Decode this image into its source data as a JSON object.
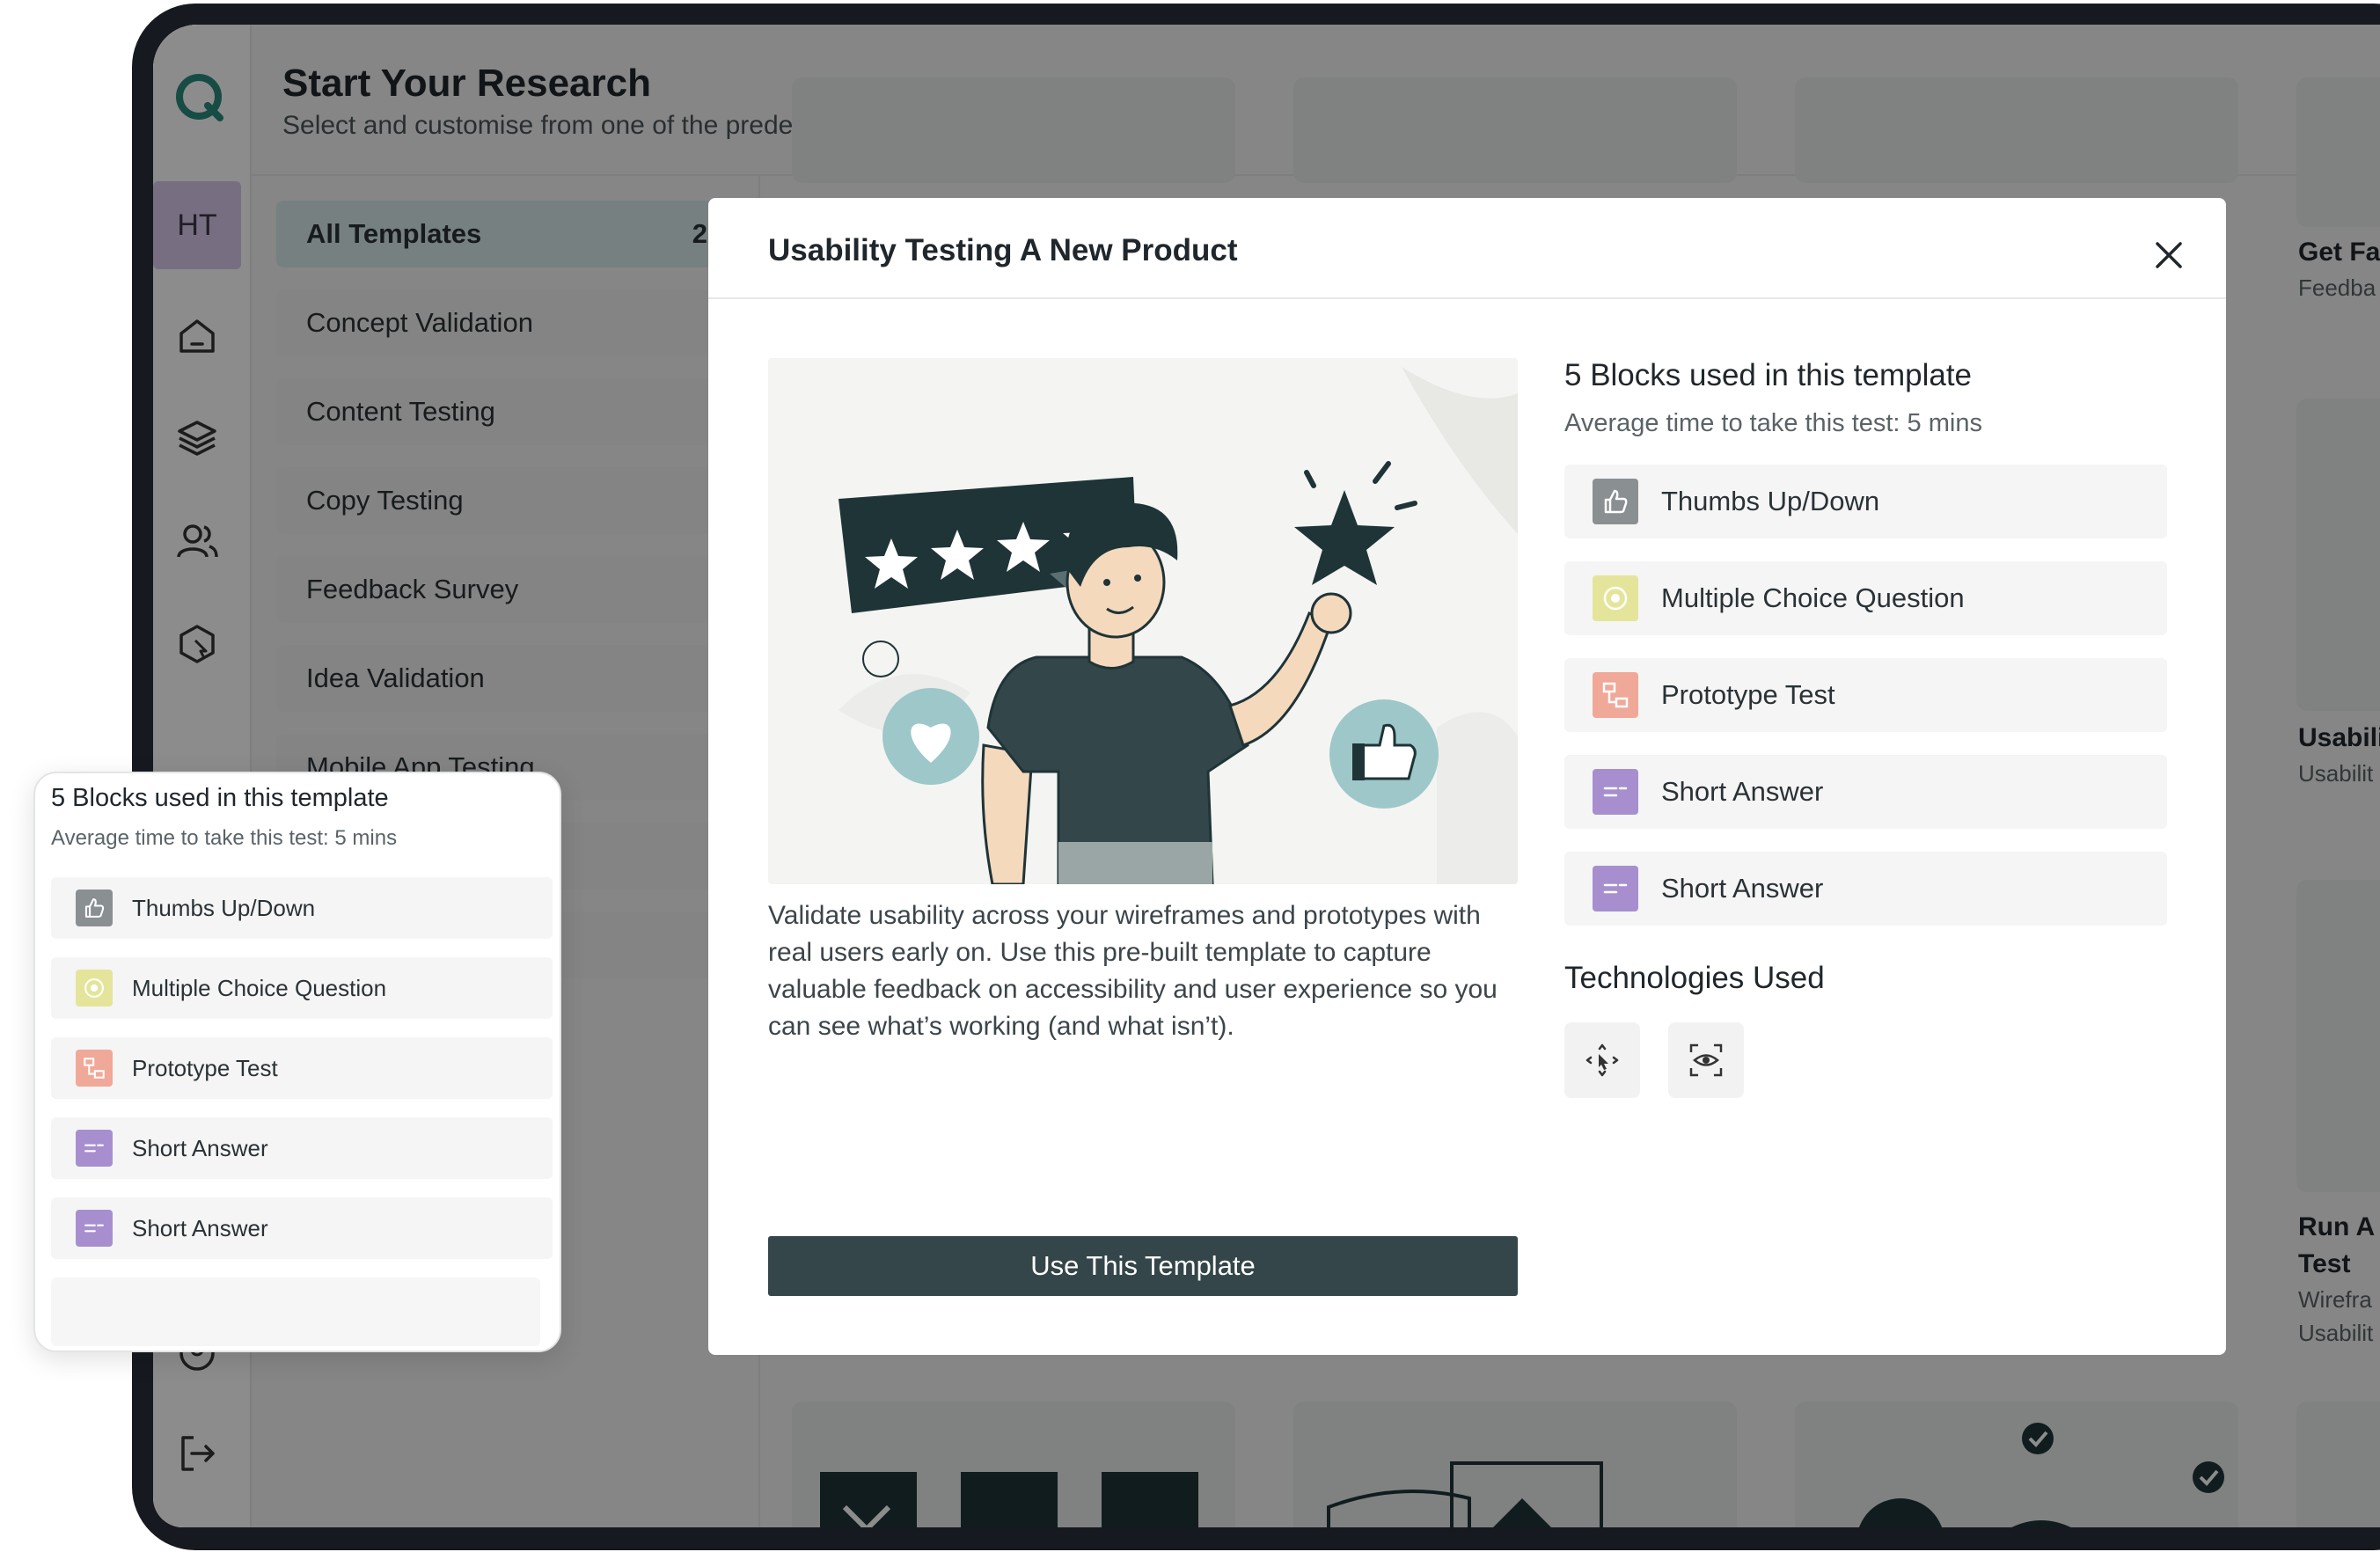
{
  "header": {
    "title": "Start Your Research",
    "subtitle": "Select and customise from one of the predefined templates"
  },
  "sidebar": {
    "avatar_initials": "HT",
    "icons": [
      "logo-icon",
      "home-icon",
      "layers-icon",
      "users-icon",
      "cursor-click-icon",
      "user-icon",
      "logout-icon"
    ]
  },
  "categories": [
    {
      "label": "All Templates",
      "count": "2"
    },
    {
      "label": "Concept Validation",
      "count": ""
    },
    {
      "label": "Content Testing",
      "count": ""
    },
    {
      "label": "Copy Testing",
      "count": ""
    },
    {
      "label": "Feedback Survey",
      "count": ""
    },
    {
      "label": "Idea Validation",
      "count": ""
    },
    {
      "label": "Mobile App Testing",
      "count": ""
    }
  ],
  "right_cards": [
    {
      "title": "Get Fa",
      "sub": "Feedba"
    },
    {
      "title": "Usabili",
      "sub": "Usabilit"
    },
    {
      "title_1": "Run A",
      "title_2": "Test",
      "sub_1": "Wirefra",
      "sub_2": "Usabilit"
    }
  ],
  "modal": {
    "title": "Usability Testing A New Product",
    "description": "Validate usability across your wireframes and prototypes with real users early on. Use this pre-built template to capture valuable feedback on accessibility and user experience so you can see what’s working (and what isn’t).",
    "button_label": "Use This Template",
    "blocks_title": "5 Blocks used in this template",
    "blocks_subtitle": "Average time to take this test: 5 mins",
    "blocks": [
      {
        "label": "Thumbs Up/Down",
        "icon": "thumbs-up-icon",
        "color": "#8a8f92"
      },
      {
        "label": "Multiple Choice Question",
        "icon": "radio-icon",
        "color": "#e4e59a"
      },
      {
        "label": "Prototype Test",
        "icon": "prototype-icon",
        "color": "#f0a898"
      },
      {
        "label": "Short Answer",
        "icon": "short-answer-icon",
        "color": "#a78fcf"
      },
      {
        "label": "Short Answer",
        "icon": "short-answer-icon",
        "color": "#a78fcf"
      }
    ],
    "tech_title": "Technologies Used",
    "technologies": [
      "move-cursor-icon",
      "eye-tracking-icon"
    ]
  },
  "floating_card": {
    "title": "5 Blocks used in this template",
    "subtitle": "Average time to take this test: 5 mins",
    "blocks": [
      {
        "label": "Thumbs Up/Down"
      },
      {
        "label": "Multiple Choice Question"
      },
      {
        "label": "Prototype Test"
      },
      {
        "label": "Short Answer"
      },
      {
        "label": "Short Answer"
      }
    ]
  },
  "colors": {
    "primary_button": "#344649",
    "active_category": "#d8eaea",
    "logo_teal": "#2b8a7e",
    "avatar_bg": "#d9c9ec"
  }
}
